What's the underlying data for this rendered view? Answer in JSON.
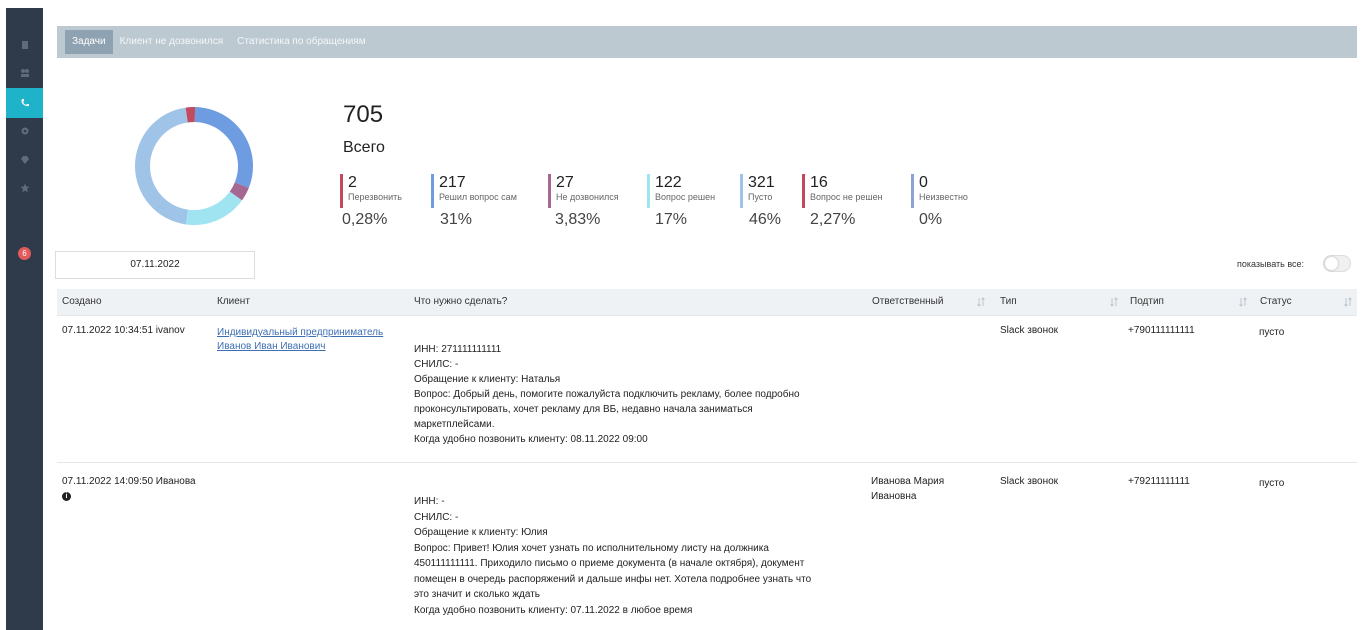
{
  "sidebar": {
    "icons": [
      "building-icon",
      "users-icon",
      "phone-icon",
      "gear-icon",
      "diamond-icon",
      "star-icon"
    ],
    "badge": "6"
  },
  "tabs": [
    {
      "label": "Задачи",
      "active": true
    },
    {
      "label": "Клиент не дозвонился",
      "active": false
    },
    {
      "label": "Статистика по обращениям",
      "active": false
    }
  ],
  "summary": {
    "total": "705",
    "total_label": "Всего",
    "stats": [
      {
        "count": "2",
        "label": "Перезвонить",
        "percent": "0,28%",
        "color": "#c2495e"
      },
      {
        "count": "217",
        "label": "Решил вопрос сам",
        "percent": "31%",
        "color": "#6e9ce0"
      },
      {
        "count": "27",
        "label": "Не дозвонился",
        "percent": "3,83%",
        "color": "#a56893"
      },
      {
        "count": "122",
        "label": "Вопрос решен",
        "percent": "17%",
        "color": "#9fe4f0"
      },
      {
        "count": "321",
        "label": "Пусто",
        "percent": "46%",
        "color": "#9fc4e8"
      },
      {
        "count": "16",
        "label": "Вопрос не решен",
        "percent": "2,27%",
        "color": "#c2495e"
      },
      {
        "count": "0",
        "label": "Неизвестно",
        "percent": "0%",
        "color": "#8ca3d6"
      }
    ]
  },
  "chart_data": {
    "type": "pie",
    "categories": [
      "Перезвонить",
      "Решил вопрос сам",
      "Не дозвонился",
      "Вопрос решен",
      "Пусто",
      "Вопрос не решен",
      "Неизвестно"
    ],
    "values": [
      2,
      217,
      27,
      122,
      321,
      16,
      0
    ]
  },
  "filter": {
    "date": "07.11.2022",
    "show_all_label": "показывать все:"
  },
  "table": {
    "headers": [
      "Создано",
      "Клиент",
      "Что нужно сделать?",
      "Ответственный",
      "Тип",
      "Подтип",
      "Статус"
    ],
    "rows": [
      {
        "created": "07.11.2022 10:34:51 ivanov",
        "client_line1": "Индивидуальный предприниматель",
        "client_line2": "Иванов Иван Иванович",
        "desc": [
          "ИНН: 271111111111",
          "СНИЛС: -",
          "Обращение к клиенту: Наталья",
          "Вопрос: Добрый день, помогите пожалуйста подключить рекламу, более подробно",
          "проконсультировать, хочет рекламу для ВБ, недавно начала заниматься",
          "маркетплейсами.",
          "Когда удобно позвонить клиенту: 08.11.2022 09:00"
        ],
        "responsible_line1": "",
        "responsible_line2": "",
        "type": "Slack звонок",
        "subtype": "+790111111111",
        "status": "пусто"
      },
      {
        "created": "07.11.2022 14:09:50 Иванова",
        "info": "i",
        "desc": [
          "ИНН: -",
          "СНИЛС: -",
          "Обращение к клиенту: Юлия",
          "Вопрос: Привет! Юлия хочет узнать по исполнительному листу на должника",
          "450111111111. Приходило письмо о приеме документа (в начале октября), документ",
          "помещен в очередь распоряжений и дальше инфы нет. Хотела подробнее узнать что",
          "это значит и сколько ждать",
          "Когда удобно позвонить клиенту: 07.11.2022 в любое время"
        ],
        "responsible_line1": "Иванова Мария",
        "responsible_line2": "Ивановна",
        "type": "Slack звонок",
        "subtype": "+79211111111",
        "status": "пусто"
      }
    ]
  }
}
